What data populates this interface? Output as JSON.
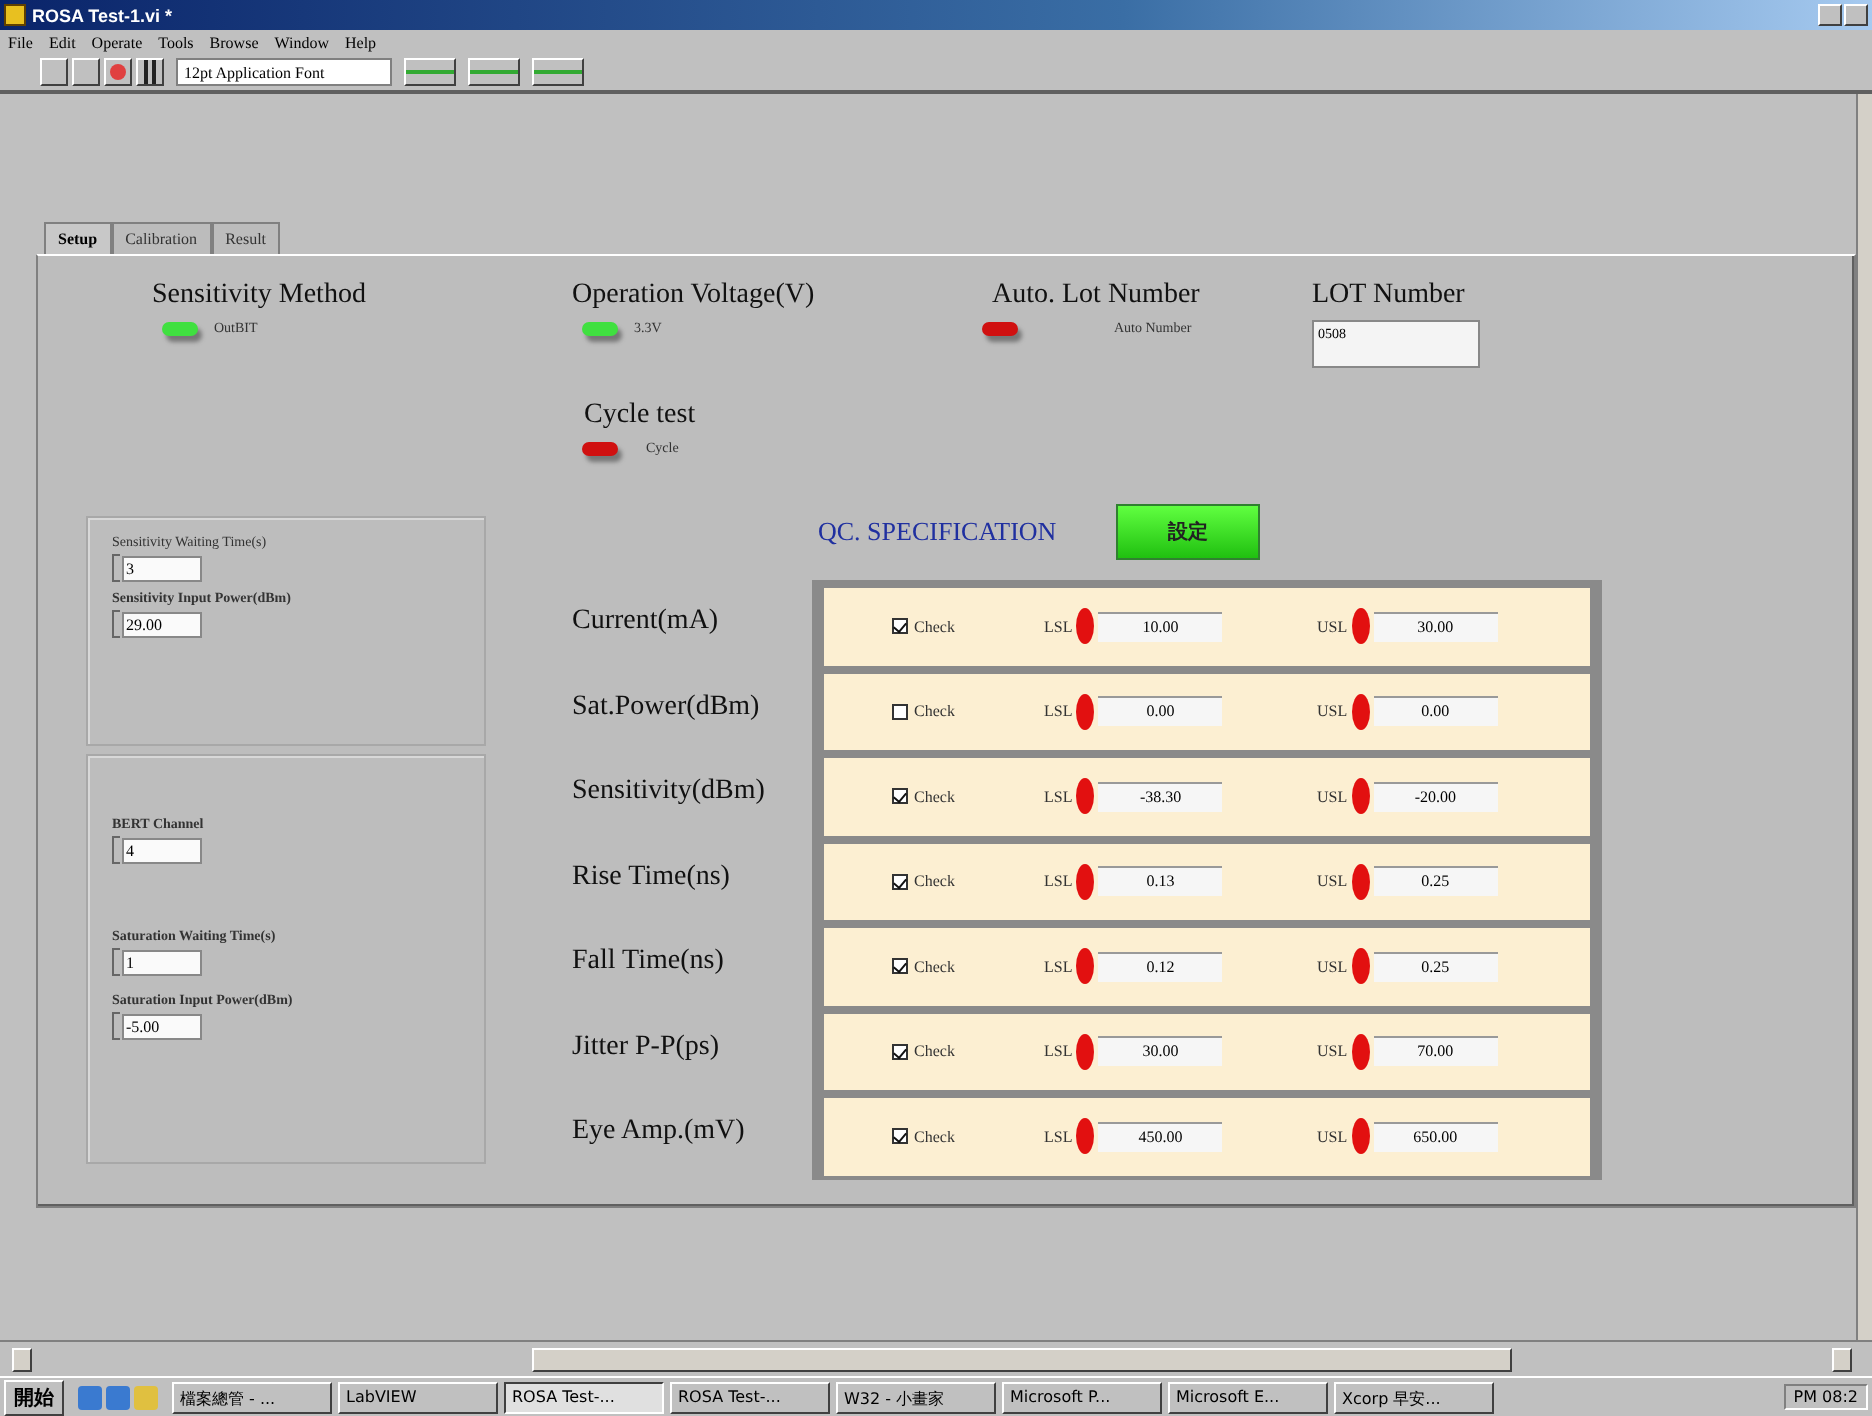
{
  "window": {
    "title": "ROSA Test-1.vi *"
  },
  "menu": [
    "File",
    "Edit",
    "Operate",
    "Tools",
    "Browse",
    "Window",
    "Help"
  ],
  "toolbar": {
    "font": "12pt Application Font"
  },
  "tabs": [
    {
      "label": "Setup",
      "selected": true
    },
    {
      "label": "Calibration",
      "selected": false
    },
    {
      "label": "Result",
      "selected": false
    }
  ],
  "switches": [
    {
      "label": "Sensitivity Method",
      "caption": "OutBIT",
      "on": true
    },
    {
      "label": "Operation Voltage(V)",
      "caption": "3.3V",
      "on": true
    },
    {
      "label": "Auto. Lot Number",
      "caption": "Auto Number",
      "on": false
    }
  ],
  "lot_number": {
    "label": "LOT Number",
    "value": "0508"
  },
  "cycle_test": {
    "label": "Cycle test",
    "caption": "Cycle",
    "on": false
  },
  "left_panels": [
    {
      "fields": [
        {
          "label": "Sensitivity Waiting Time(s)",
          "value": "3"
        },
        {
          "label": "Sensitivity Input Power(dBm)",
          "value": "29.00"
        }
      ]
    },
    {
      "fields": [
        {
          "label": "BERT Channel",
          "value": "4"
        },
        {
          "label": "Saturation Waiting Time(s)",
          "value": "1"
        },
        {
          "label": "Saturation Input Power(dBm)",
          "value": "-5.00"
        }
      ]
    }
  ],
  "qc": {
    "title": "QC. SPECIFICATION",
    "button": "設定",
    "rows": [
      {
        "label": "Current(mA)",
        "check": "Check",
        "checked": true,
        "lsl_label": "LSL",
        "lsl": "10.00",
        "usl_label": "USL",
        "usl": "30.00"
      },
      {
        "label": "Sat.Power(dBm)",
        "check": "Check",
        "checked": false,
        "lsl_label": "LSL",
        "lsl": "0.00",
        "usl_label": "USL",
        "usl": "0.00"
      },
      {
        "label": "Sensitivity(dBm)",
        "check": "Check",
        "checked": true,
        "lsl_label": "LSL",
        "lsl": "-38.30",
        "usl_label": "USL",
        "usl": "-20.00"
      },
      {
        "label": "Rise Time(ns)",
        "check": "Check",
        "checked": true,
        "lsl_label": "LSL",
        "lsl": "0.13",
        "usl_label": "USL",
        "usl": "0.25"
      },
      {
        "label": "Fall Time(ns)",
        "check": "Check",
        "checked": true,
        "lsl_label": "LSL",
        "lsl": "0.12",
        "usl_label": "USL",
        "usl": "0.25"
      },
      {
        "label": "Jitter P-P(ps)",
        "check": "Check",
        "checked": true,
        "lsl_label": "LSL",
        "lsl": "30.00",
        "usl_label": "USL",
        "usl": "70.00"
      },
      {
        "label": "Eye Amp.(mV)",
        "check": "Check",
        "checked": true,
        "lsl_label": "LSL",
        "lsl": "450.00",
        "usl_label": "USL",
        "usl": "650.00"
      }
    ]
  },
  "taskbar": {
    "start": "開始",
    "items": [
      {
        "label": "檔案總管 - ...",
        "active": false
      },
      {
        "label": "LabVIEW",
        "active": false
      },
      {
        "label": "ROSA Test-...",
        "active": true
      },
      {
        "label": "ROSA Test-...",
        "active": false
      },
      {
        "label": "W32 - 小畫家",
        "active": false
      },
      {
        "label": "Microsoft P...",
        "active": false
      },
      {
        "label": "Microsoft E...",
        "active": false
      },
      {
        "label": "Xcorp 早安...",
        "active": false
      }
    ],
    "clock": "PM 08:2"
  }
}
